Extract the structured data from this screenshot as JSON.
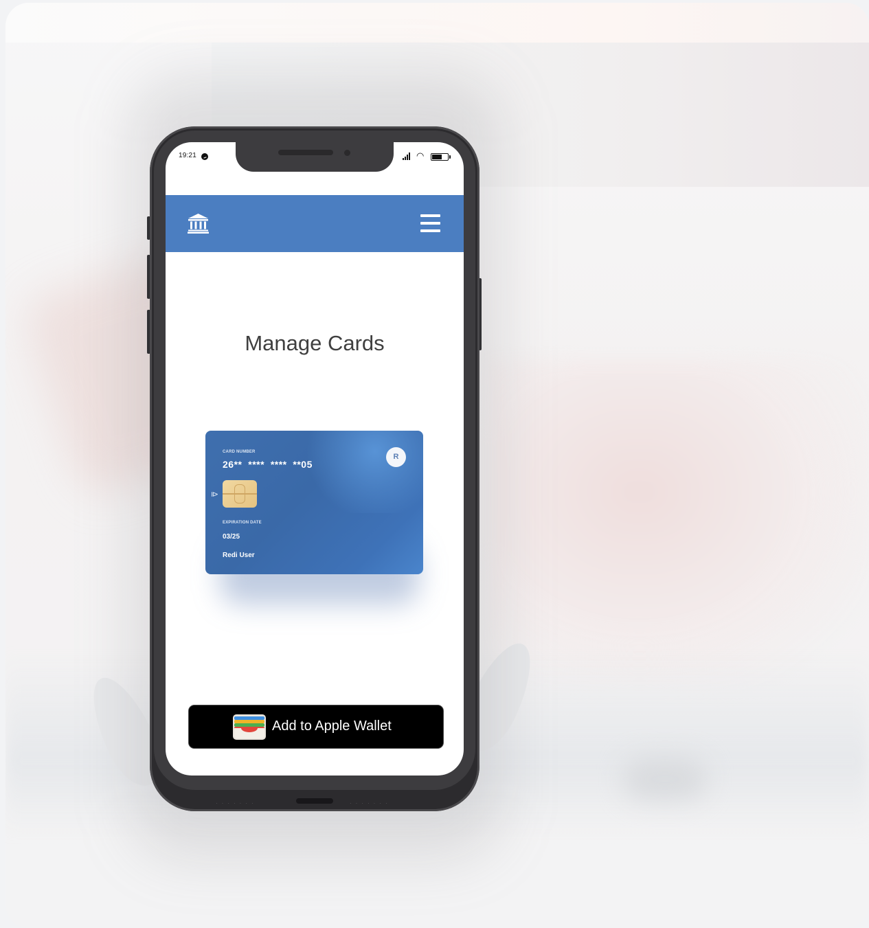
{
  "status_bar": {
    "time": "19:21"
  },
  "app_bar": {
    "brand_icon": "bank-icon",
    "menu_icon": "hamburger-menu-icon",
    "color": "#4b7ec1"
  },
  "page": {
    "title": "Manage Cards"
  },
  "card": {
    "number_label": "CARD NUMBER",
    "number": "26**  ****  ****  **05",
    "expiry_label": "EXPIRATION DATE",
    "expiry": "03/25",
    "holder": "Redi User",
    "logo": "R",
    "colors": {
      "start": "#3f6fae",
      "end": "#4a85cc"
    }
  },
  "wallet_button": {
    "label": "Add to Apple Wallet",
    "icon": "apple-wallet-icon"
  }
}
